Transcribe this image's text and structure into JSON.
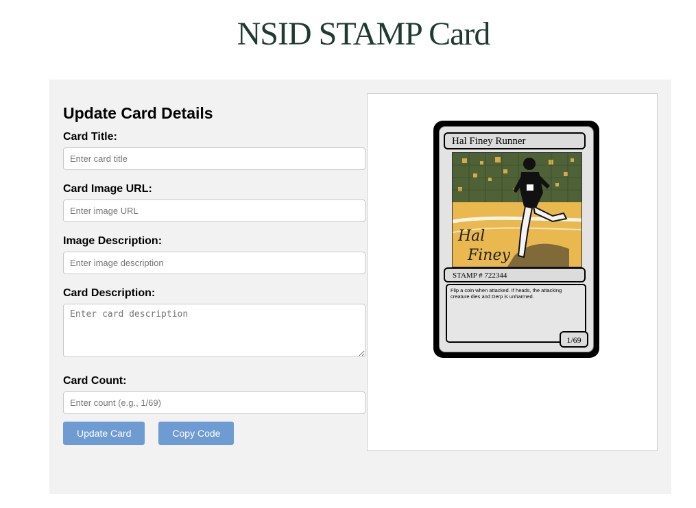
{
  "page": {
    "title": "NSID STAMP Card"
  },
  "form": {
    "heading": "Update Card Details",
    "title_label": "Card Title:",
    "title_placeholder": "Enter card title",
    "image_url_label": "Card Image URL:",
    "image_url_placeholder": "Enter image URL",
    "image_desc_label": "Image Description:",
    "image_desc_placeholder": "Enter image description",
    "card_desc_label": "Card Description:",
    "card_desc_placeholder": "Enter card description",
    "count_label": "Card Count:",
    "count_placeholder": "Enter count (e.g., 1/69)",
    "update_button": "Update Card",
    "copy_button": "Copy Code"
  },
  "card": {
    "title": "Hal Finey Runner",
    "image_text_line1": "Hal",
    "image_text_line2": "Finey",
    "stamp": "STAMP # 722344",
    "description": "Flip a coin when attacked. If heads, the attacking creature dies and Derp is unharmed.",
    "count": "1/69"
  },
  "colors": {
    "title": "#1f3b2f",
    "button": "#6e9bd1",
    "panel": "#f2f2f2",
    "art_green": "#4f6136",
    "art_gold": "#e9b94f"
  }
}
